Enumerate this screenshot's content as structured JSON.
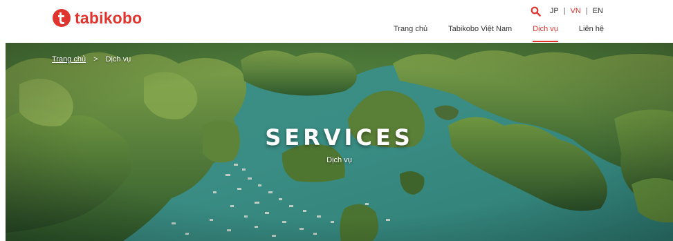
{
  "brand": {
    "name": "tabikobo",
    "color": "#e0352f"
  },
  "languages": [
    {
      "label": "JP",
      "active": false
    },
    {
      "label": "VN",
      "active": true
    },
    {
      "label": "EN",
      "active": false
    }
  ],
  "lang_separator": "|",
  "nav": [
    {
      "label": "Trang chủ",
      "active": false
    },
    {
      "label": "Tabikobo Việt Nam",
      "active": false
    },
    {
      "label": "Dịch vụ",
      "active": true
    },
    {
      "label": "Liên hệ",
      "active": false
    }
  ],
  "breadcrumb": {
    "home": "Trang chủ",
    "separator": ">",
    "current": "Dịch vụ"
  },
  "hero": {
    "title": "SERVICES",
    "subtitle": "Dịch vụ",
    "background": "aerial-bay-karst-islands"
  },
  "icons": {
    "search": "search-icon",
    "logo": "tabikobo-logo-icon"
  }
}
